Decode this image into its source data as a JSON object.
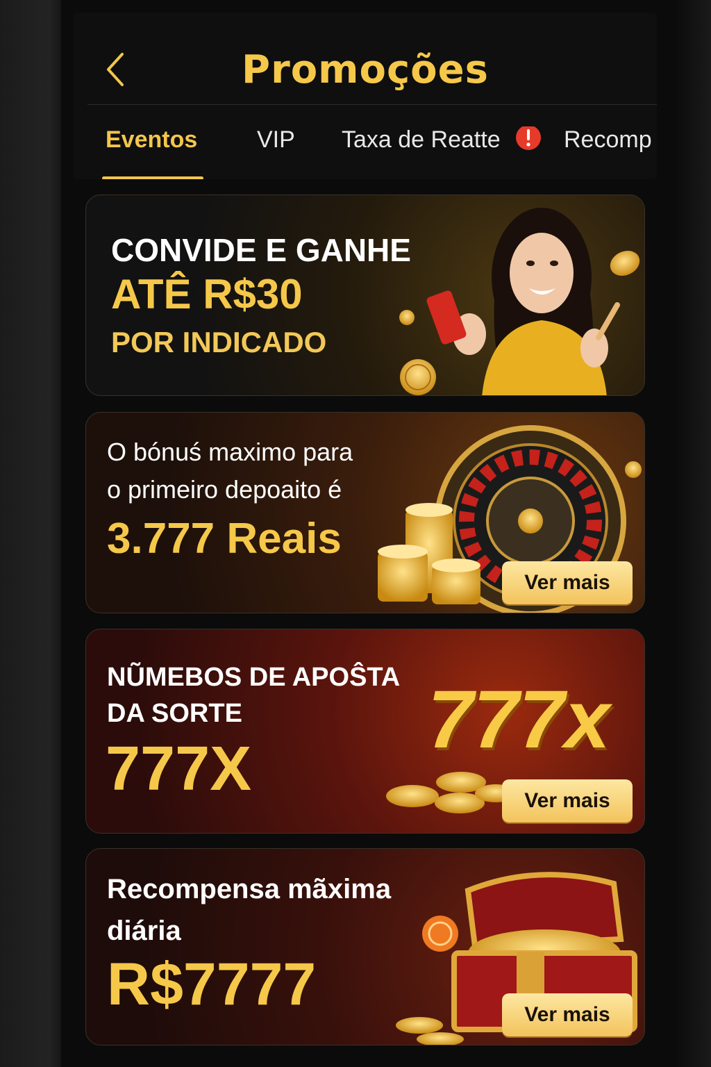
{
  "header": {
    "title": "Promoções"
  },
  "tabs": [
    {
      "label": "Eventos",
      "active": true
    },
    {
      "label": "VIP",
      "active": false
    },
    {
      "label": "Taxa de Reatte",
      "active": false,
      "badge": "alert-icon"
    },
    {
      "label": "Recomp",
      "active": false
    }
  ],
  "promos": [
    {
      "lines": [
        "CONVIDE E GANHE",
        "ATÊ R$30",
        "POR INDICADO"
      ]
    },
    {
      "lines": [
        "O bónuś maximo para",
        "o primeiro depoaito é",
        "3.777 Reais"
      ],
      "button": "Ver mais"
    },
    {
      "lines": [
        "NŨMEBOS DE APOŜTA",
        "DA SORTE",
        "777X"
      ],
      "big": "777x",
      "button": "Ver mais"
    },
    {
      "lines": [
        "Recompensa mãxima",
        "diária",
        "R$7777"
      ],
      "button": "Ver mais"
    }
  ],
  "colors": {
    "accent": "#f6c84a",
    "background": "#0b0b0b"
  }
}
